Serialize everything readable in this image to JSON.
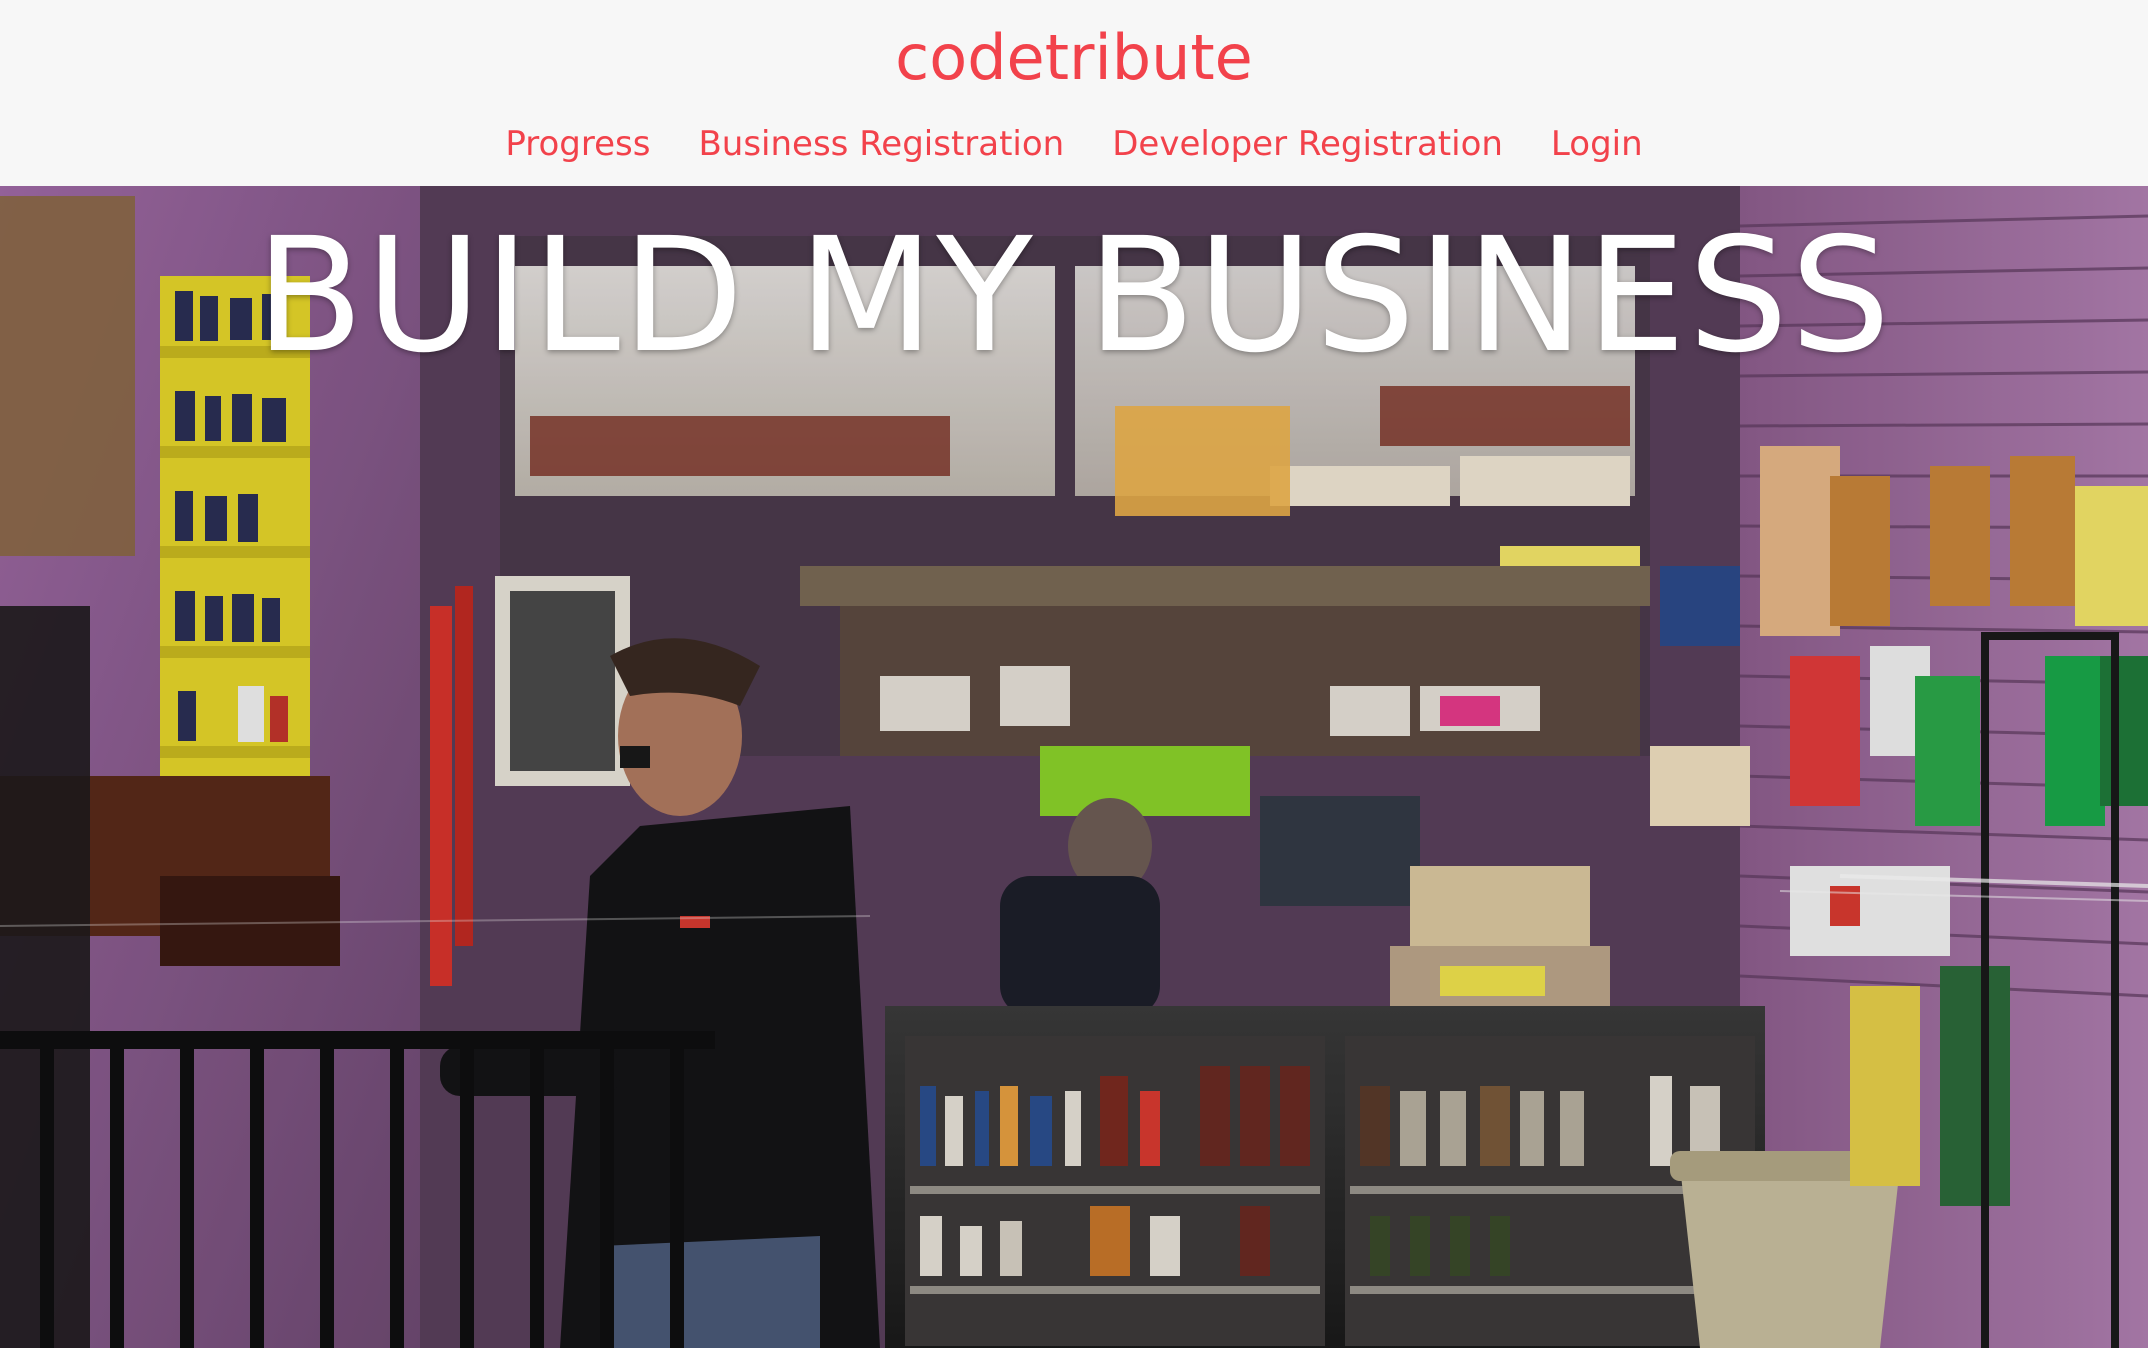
{
  "header": {
    "brand": "codetribute",
    "nav": [
      {
        "label": "Progress"
      },
      {
        "label": "Business Registration"
      },
      {
        "label": "Developer Registration"
      },
      {
        "label": "Login"
      }
    ]
  },
  "hero": {
    "title": "BUILD MY BUSINESS"
  },
  "colors": {
    "accent": "#f2424b",
    "header_bg": "#f7f7f7",
    "hero_title": "#ffffff"
  }
}
